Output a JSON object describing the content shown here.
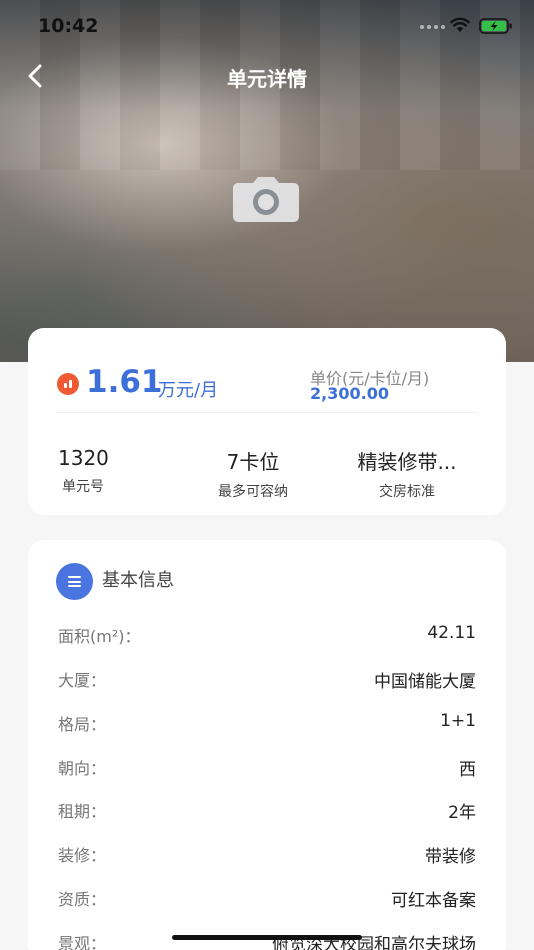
{
  "status_bar": {
    "time": "10:42"
  },
  "nav": {
    "title": "单元详情",
    "back_icon": "chevron-left-icon"
  },
  "hero": {
    "placeholder_icon": "camera-icon"
  },
  "summary": {
    "rent_value": "1.61",
    "rent_unit": "万元/月",
    "unit_price_label": "单价(元/卡位/月)",
    "unit_price_value": "2,300.00",
    "stats": [
      {
        "value": "1320",
        "label": "单元号"
      },
      {
        "value": "7卡位",
        "label": "最多可容纳"
      },
      {
        "value": "精装修带...",
        "label": "交房标准"
      }
    ]
  },
  "basic_info": {
    "title": "基本信息",
    "rows": [
      {
        "label": "面积(m²)：",
        "value": "42.11"
      },
      {
        "label": "大厦：",
        "value": "中国储能大厦"
      },
      {
        "label": "格局：",
        "value": "1+1"
      },
      {
        "label": "朝向：",
        "value": "西"
      },
      {
        "label": "租期：",
        "value": "2年"
      },
      {
        "label": "装修：",
        "value": "带装修"
      },
      {
        "label": "资质：",
        "value": "可红本备案"
      },
      {
        "label": "景观：",
        "value": "俯览深大校园和高尔夫球场"
      }
    ]
  },
  "colors": {
    "accent": "#3c6fd8",
    "rent_icon": "#f05a33",
    "info_icon": "#4a74e0"
  }
}
